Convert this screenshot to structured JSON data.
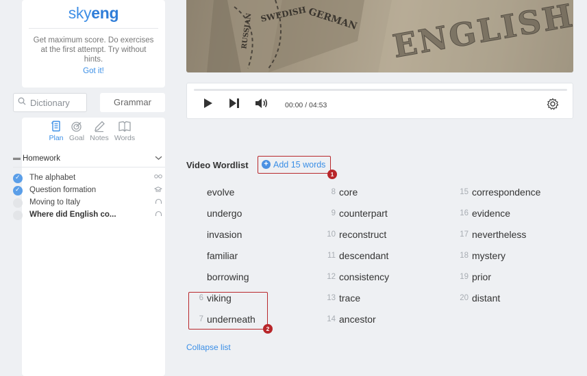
{
  "sidebar": {
    "logo": {
      "sky": "sky",
      "eng": "eng"
    },
    "tips": {
      "text": "Get maximum score. Do exercises at the first attempt. Try without hints.",
      "got_it": "Got it!"
    },
    "dictionary_placeholder": "Dictionary",
    "grammar_label": "Grammar",
    "plan_tabs": [
      {
        "label": "Plan",
        "icon": "plan-icon",
        "active": true
      },
      {
        "label": "Goal",
        "icon": "goal-icon",
        "active": false
      },
      {
        "label": "Notes",
        "icon": "notes-icon",
        "active": false
      },
      {
        "label": "Words",
        "icon": "words-icon",
        "active": false
      }
    ],
    "homework_label": "Homework",
    "lessons": [
      {
        "title": "The alphabet",
        "done": true,
        "icon": "glasses-icon"
      },
      {
        "title": "Question formation",
        "done": true,
        "icon": "graduation-cap-icon"
      },
      {
        "title": "Moving to Italy",
        "done": false,
        "icon": "headphones-icon"
      },
      {
        "title": "Where did English co...",
        "done": false,
        "icon": "headphones-icon",
        "current": true
      }
    ]
  },
  "video": {
    "labels": [
      "RUSSIAN",
      "SWEDISH",
      "GERMAN",
      "ENGLISH"
    ],
    "time": "00:00 / 04:53"
  },
  "wordlist": {
    "title": "Video Wordlist",
    "add_words": "Add 15 words",
    "columns": [
      [
        {
          "num": "",
          "word": "evolve"
        },
        {
          "num": "",
          "word": "undergo"
        },
        {
          "num": "",
          "word": "invasion"
        },
        {
          "num": "",
          "word": "familiar"
        },
        {
          "num": "",
          "word": "borrowing"
        },
        {
          "num": "6",
          "word": "viking"
        },
        {
          "num": "7",
          "word": "underneath"
        }
      ],
      [
        {
          "num": "8",
          "word": "core"
        },
        {
          "num": "9",
          "word": "counterpart"
        },
        {
          "num": "10",
          "word": "reconstruct"
        },
        {
          "num": "11",
          "word": "descendant"
        },
        {
          "num": "12",
          "word": "consistency"
        },
        {
          "num": "13",
          "word": "trace"
        },
        {
          "num": "14",
          "word": "ancestor"
        }
      ],
      [
        {
          "num": "15",
          "word": "correspondence"
        },
        {
          "num": "16",
          "word": "evidence"
        },
        {
          "num": "17",
          "word": "nevertheless"
        },
        {
          "num": "18",
          "word": "mystery"
        },
        {
          "num": "19",
          "word": "prior"
        },
        {
          "num": "20",
          "word": "distant"
        }
      ]
    ],
    "collapse": "Collapse list"
  },
  "annotations": {
    "badge_1": "1",
    "badge_2": "2"
  },
  "colors": {
    "accent": "#3a8ee6",
    "annotation_red": "#b8262a"
  }
}
